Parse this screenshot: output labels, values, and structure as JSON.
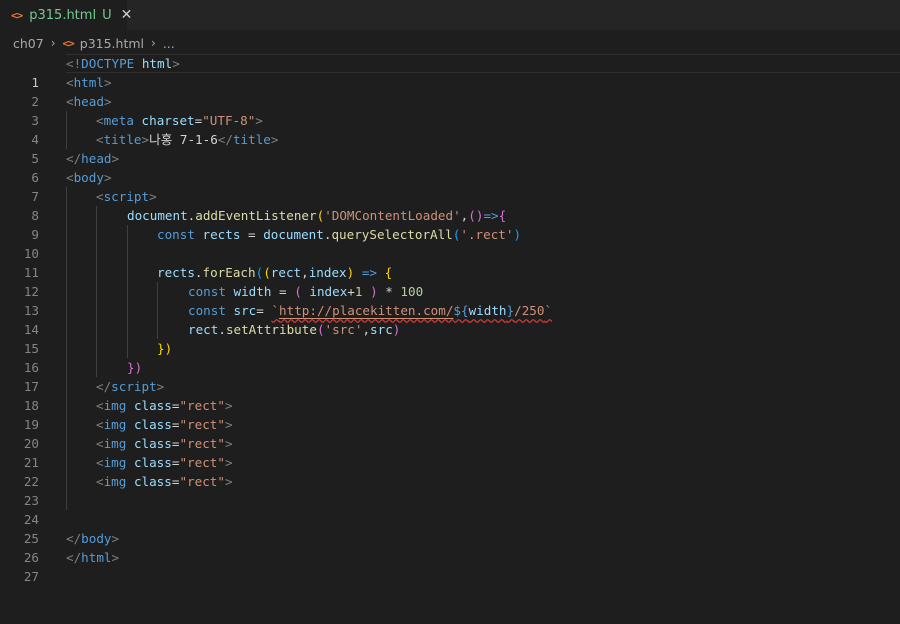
{
  "tab": {
    "icon": "html-file-icon",
    "filename": "p315.html",
    "status": "U",
    "close": "✕"
  },
  "breadcrumb": {
    "folder": "ch07",
    "file": "p315.html",
    "more": "..."
  },
  "lines": [
    {
      "n": "1"
    },
    {
      "n": "2"
    },
    {
      "n": "3"
    },
    {
      "n": "4"
    },
    {
      "n": "5"
    },
    {
      "n": "6"
    },
    {
      "n": "7"
    },
    {
      "n": "8"
    },
    {
      "n": "9"
    },
    {
      "n": "10"
    },
    {
      "n": "11"
    },
    {
      "n": "12"
    },
    {
      "n": "13"
    },
    {
      "n": "14"
    },
    {
      "n": "15"
    },
    {
      "n": "16"
    },
    {
      "n": "17"
    },
    {
      "n": "18"
    },
    {
      "n": "19"
    },
    {
      "n": "20"
    },
    {
      "n": "21"
    },
    {
      "n": "22"
    },
    {
      "n": "23"
    },
    {
      "n": "24"
    },
    {
      "n": "25"
    },
    {
      "n": "26"
    },
    {
      "n": "27"
    }
  ],
  "code": {
    "l1": [
      "<!",
      "DOCTYPE",
      " ",
      "html",
      ">"
    ],
    "l2": [
      "<",
      "html",
      ">"
    ],
    "l3": [
      "<",
      "head",
      ">"
    ],
    "l4": [
      "<",
      "meta",
      " ",
      "charset",
      "=",
      "\"UTF-8\"",
      ">"
    ],
    "l5": [
      "<",
      "title",
      ">",
      "나홍 7-1-6",
      "</",
      "title",
      ">"
    ],
    "l6": [
      "</",
      "head",
      ">"
    ],
    "l7": [
      "<",
      "body",
      ">"
    ],
    "l8": [
      "<",
      "script",
      ">"
    ],
    "l9": [
      "document",
      ".",
      "addEventListener",
      "(",
      "'DOMContentLoaded'",
      ",",
      "()",
      "=>",
      "{"
    ],
    "l10": [
      "const",
      " ",
      "rects",
      " = ",
      "document",
      ".",
      "querySelectorAll",
      "(",
      "'.rect'",
      ")"
    ],
    "l12": [
      "rects",
      ".",
      "forEach",
      "(",
      "(",
      "rect",
      ",",
      "index",
      ")",
      " ",
      "=>",
      " ",
      "{"
    ],
    "l13": [
      "const",
      " ",
      "width",
      " = ",
      "(",
      " ",
      "index",
      "+",
      "1",
      " ",
      ")",
      " * ",
      "100"
    ],
    "l14": [
      "const",
      " ",
      "src",
      "= ",
      "`",
      "http://placekitten.com/",
      "${",
      "width",
      "}",
      "/250",
      "`"
    ],
    "l15": [
      "rect",
      ".",
      "setAttribute",
      "(",
      "'src'",
      ",",
      "src",
      ")"
    ],
    "l16": [
      "})"
    ],
    "l17": [
      "})"
    ],
    "l18": [
      "</",
      "script",
      ">"
    ],
    "img": [
      "<",
      "img",
      " ",
      "class",
      "=",
      "\"rect\"",
      ">"
    ],
    "l26": [
      "</",
      "body",
      ">"
    ],
    "l27": [
      "</",
      "html",
      ">"
    ]
  },
  "colors": {
    "background": "#1e1e1e",
    "tag": "#569cd6",
    "attribute": "#9cdcfe",
    "string": "#ce9178",
    "function": "#dcdcaa",
    "number": "#b5cea8",
    "modified": "#73c991"
  }
}
